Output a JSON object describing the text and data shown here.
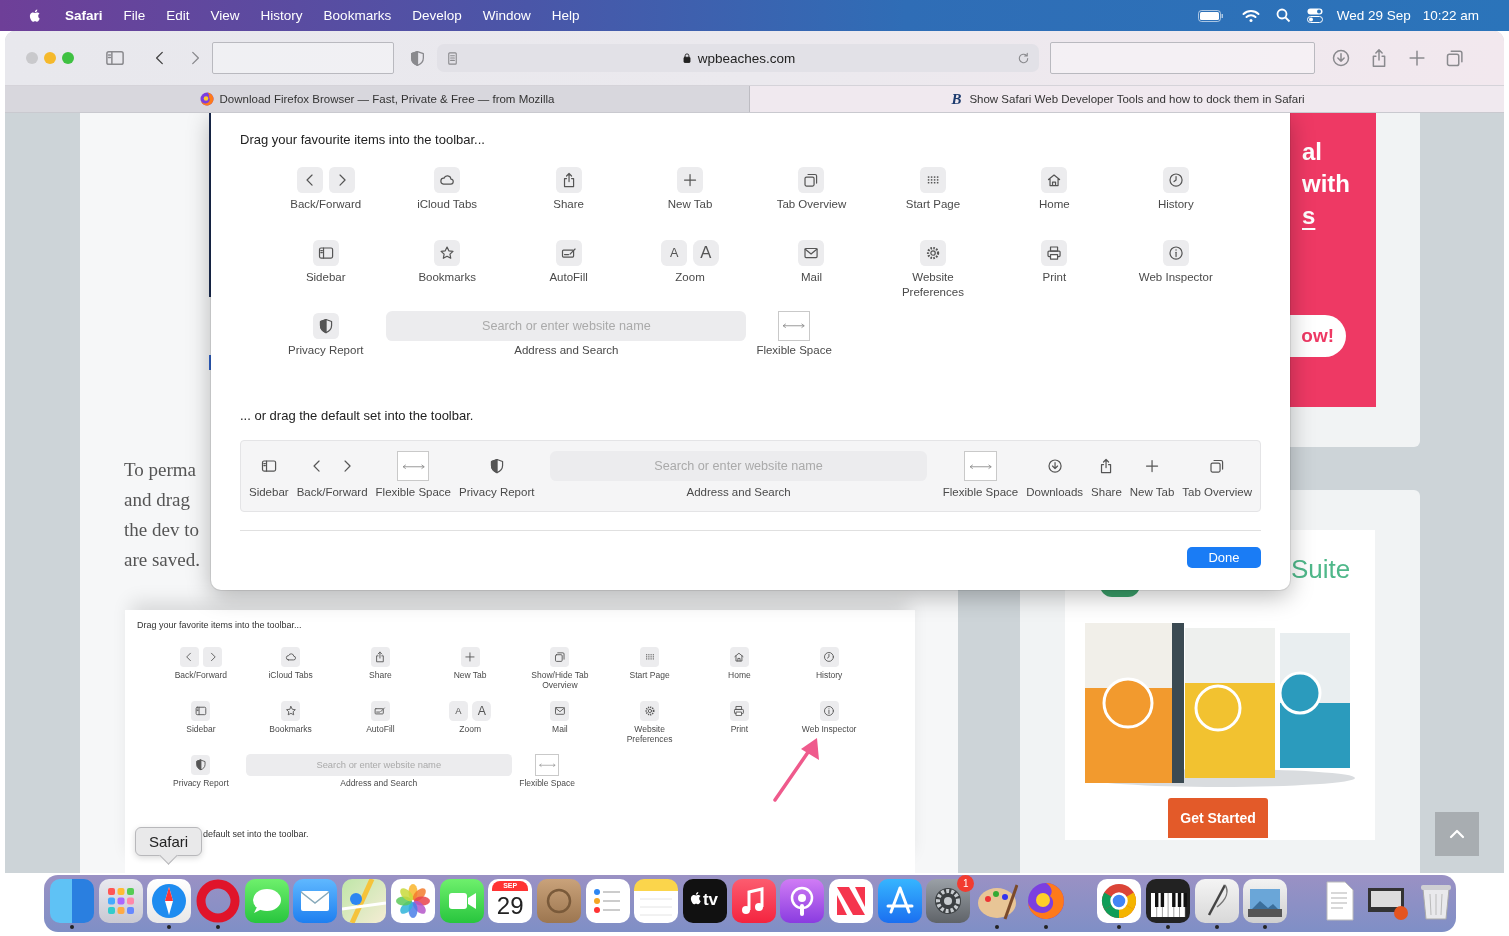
{
  "menubar": {
    "app": "Safari",
    "menus": [
      "File",
      "Edit",
      "View",
      "History",
      "Bookmarks",
      "Develop",
      "Window",
      "Help"
    ],
    "date": "Wed 29 Sep",
    "time": "10:22 am"
  },
  "toolbar": {
    "address": "wpbeaches.com"
  },
  "tabs": [
    {
      "title": "Download Firefox Browser — Fast, Private & Free — from Mozilla",
      "favicon": {
        "kind": "globe"
      },
      "selected": false
    },
    {
      "title": "Show Safari Web Developer Tools and how to dock them in Safari",
      "favicon": {
        "kind": "letter",
        "text": "B"
      },
      "selected": true
    }
  ],
  "page": {
    "paragraph_lines": [
      "To perma",
      "and drag",
      "the dev to",
      "are saved."
    ],
    "banner_lines": [
      {
        "text": "al",
        "underline": false
      },
      {
        "text": "with",
        "underline": false
      },
      {
        "text": "s",
        "underline": true
      }
    ],
    "banner_button": "ow!",
    "promo_title": "Suite",
    "promo_button": "Get Started",
    "embedded": {
      "title": "Drag your favorite items into the toolbar...",
      "items": [
        {
          "label": "Back/Forward",
          "kind": "backfwd"
        },
        {
          "label": "iCloud Tabs",
          "kind": "cloud"
        },
        {
          "label": "Share",
          "kind": "share"
        },
        {
          "label": "New Tab",
          "kind": "plus"
        },
        {
          "label": "Show/Hide Tab Overview",
          "kind": "tabs"
        },
        {
          "label": "Start Page",
          "kind": "grid"
        },
        {
          "label": "Home",
          "kind": "home"
        },
        {
          "label": "History",
          "kind": "clock"
        },
        {
          "label": "Sidebar",
          "kind": "sidebar"
        },
        {
          "label": "Bookmarks",
          "kind": "star"
        },
        {
          "label": "AutoFill",
          "kind": "autofill"
        },
        {
          "label": "Zoom",
          "kind": "zoom",
          "keys": [
            "A",
            "A"
          ]
        },
        {
          "label": "Mail",
          "kind": "mail"
        },
        {
          "label": "Website Preferences",
          "kind": "gear"
        },
        {
          "label": "Print",
          "kind": "print"
        },
        {
          "label": "Web Inspector",
          "kind": "info"
        },
        {
          "label": "Privacy Report",
          "kind": "shield"
        },
        {
          "label": "Address and Search",
          "kind": "address",
          "placeholder": "Search or enter website name"
        },
        {
          "label": "Flexible Space",
          "kind": "flex"
        }
      ],
      "default_title": "default set into the toolbar."
    }
  },
  "sheet": {
    "title": "Drag your favourite items into the toolbar...",
    "items": [
      {
        "label": "Back/Forward",
        "kind": "backfwd"
      },
      {
        "label": "iCloud Tabs",
        "kind": "cloud"
      },
      {
        "label": "Share",
        "kind": "share"
      },
      {
        "label": "New Tab",
        "kind": "plus"
      },
      {
        "label": "Tab Overview",
        "kind": "tabs"
      },
      {
        "label": "Start Page",
        "kind": "grid"
      },
      {
        "label": "Home",
        "kind": "home"
      },
      {
        "label": "History",
        "kind": "clock"
      },
      {
        "label": "Sidebar",
        "kind": "sidebar"
      },
      {
        "label": "Bookmarks",
        "kind": "star"
      },
      {
        "label": "AutoFill",
        "kind": "autofill"
      },
      {
        "label": "Zoom",
        "kind": "zoom",
        "keys": [
          "A",
          "A"
        ]
      },
      {
        "label": "Mail",
        "kind": "mail"
      },
      {
        "label": "Website Preferences",
        "kind": "gear"
      },
      {
        "label": "Print",
        "kind": "print"
      },
      {
        "label": "Web Inspector",
        "kind": "info"
      },
      {
        "label": "Privacy Report",
        "kind": "shield"
      },
      {
        "label": "Address and Search",
        "kind": "address",
        "placeholder": "Search or enter website name"
      },
      {
        "label": "Flexible Space",
        "kind": "flex"
      }
    ],
    "default_title": "... or drag the default set into the toolbar.",
    "default_items": [
      {
        "label": "Sidebar",
        "kind": "sidebar"
      },
      {
        "label": "Back/Forward",
        "kind": "backfwd"
      },
      {
        "label": "Flexible Space",
        "kind": "flex"
      },
      {
        "label": "Privacy Report",
        "kind": "shield"
      },
      {
        "label": "Address and Search",
        "kind": "address",
        "placeholder": "Search or enter website name"
      },
      {
        "label": "Flexible Space",
        "kind": "flex"
      },
      {
        "label": "Downloads",
        "kind": "download"
      },
      {
        "label": "Share",
        "kind": "share"
      },
      {
        "label": "New Tab",
        "kind": "plus"
      },
      {
        "label": "Tab Overview",
        "kind": "tabs"
      }
    ],
    "done": "Done"
  },
  "tooltip": "Safari",
  "dock": [
    {
      "kind": "finder",
      "running": true
    },
    {
      "kind": "launchpad",
      "running": false
    },
    {
      "kind": "safari",
      "running": true
    },
    {
      "kind": "opera",
      "running": true
    },
    {
      "kind": "messages",
      "running": false
    },
    {
      "kind": "mail",
      "running": false
    },
    {
      "kind": "maps",
      "running": false
    },
    {
      "kind": "photos",
      "running": false
    },
    {
      "kind": "facetime",
      "running": false
    },
    {
      "kind": "calendar",
      "month": "SEP",
      "day": "29",
      "running": false
    },
    {
      "kind": "contacts",
      "running": false
    },
    {
      "kind": "reminders",
      "running": false
    },
    {
      "kind": "notes",
      "running": false
    },
    {
      "kind": "tv",
      "label": "tv",
      "running": false
    },
    {
      "kind": "music",
      "running": false
    },
    {
      "kind": "podcasts",
      "running": false
    },
    {
      "kind": "news",
      "running": false
    },
    {
      "kind": "appstore",
      "running": false
    },
    {
      "kind": "settings",
      "badge": "1",
      "running": false
    },
    {
      "kind": "paint",
      "running": true
    },
    {
      "kind": "firefox",
      "running": true
    },
    {
      "kind": "separator"
    },
    {
      "kind": "chrome",
      "running": true
    },
    {
      "kind": "piano",
      "running": true
    },
    {
      "kind": "quill",
      "running": true
    },
    {
      "kind": "preview",
      "running": true
    },
    {
      "kind": "separator"
    },
    {
      "kind": "document",
      "running": false
    },
    {
      "kind": "screenshot",
      "running": false
    },
    {
      "kind": "trash",
      "running": false
    }
  ]
}
